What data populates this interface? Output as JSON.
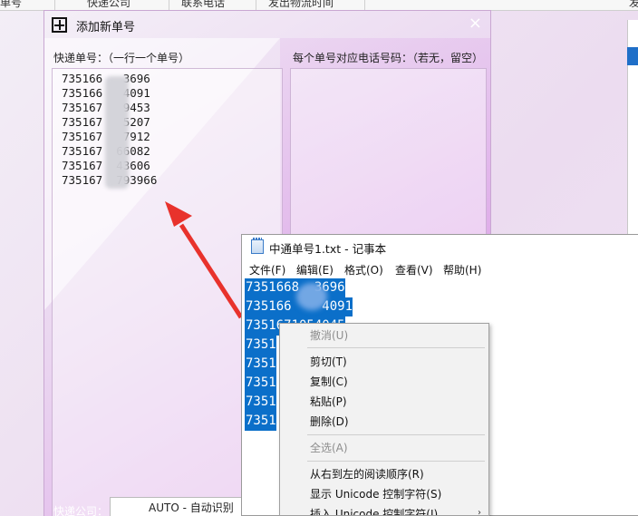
{
  "background_app": {
    "columns": [
      "单号",
      "快递公司",
      "联系电话",
      "发出物流时间"
    ],
    "right_label": "发"
  },
  "dialog": {
    "title": "添加新单号",
    "close_symbol": "×",
    "express_label": "快递单号：（一行一个单号）",
    "phone_label": "每个单号对应电话号码：（若无，留空）",
    "tracking_lines": [
      "735166   3696",
      "735166   4091",
      "735167   9453",
      "735167   5207",
      "735167   7912",
      "735167  66082",
      "735167  43606",
      "735167  793966"
    ],
    "company_label": "快递公司：",
    "company_value": "AUTO - 自动识别"
  },
  "notepad": {
    "title": "中通单号1.txt - 记事本",
    "menu": [
      "文件(F)",
      "编辑(E)",
      "格式(O)",
      "查看(V)",
      "帮助(H)"
    ],
    "lines": [
      "7351668  3696",
      "735166    4091",
      "7351671054045",
      "7351",
      "7351",
      "7351",
      "7351",
      "7351"
    ]
  },
  "context_menu": {
    "items": [
      {
        "label": "撤消(U)",
        "enabled": false
      },
      {
        "label": "剪切(T)",
        "enabled": true
      },
      {
        "label": "复制(C)",
        "enabled": true
      },
      {
        "label": "粘贴(P)",
        "enabled": true
      },
      {
        "label": "删除(D)",
        "enabled": true
      },
      {
        "label": "全选(A)",
        "enabled": false
      },
      {
        "label": "从右到左的阅读顺序(R)",
        "enabled": true
      },
      {
        "label": "显示 Unicode 控制字符(S)",
        "enabled": true
      },
      {
        "label": "插入 Unicode 控制字符(I)",
        "enabled": true
      }
    ],
    "submenu_arrow": "›"
  },
  "colors": {
    "selection": "#0b6fc9",
    "arrow": "#e8322c",
    "dialog_accent": "#d98be8"
  }
}
